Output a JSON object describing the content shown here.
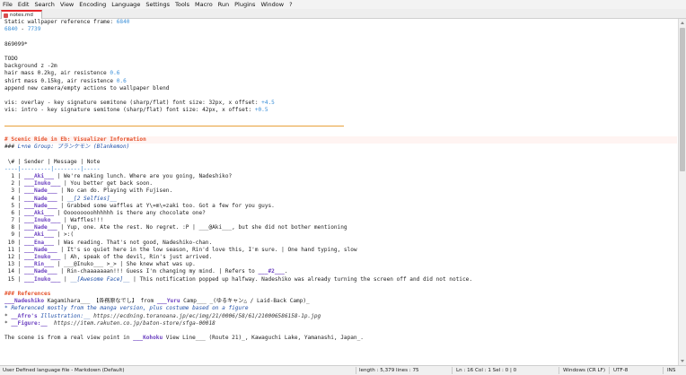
{
  "menu": [
    "File",
    "Edit",
    "Search",
    "View",
    "Encoding",
    "Language",
    "Settings",
    "Tools",
    "Macro",
    "Run",
    "Plugins",
    "Window",
    "?"
  ],
  "tab": {
    "label": "notes.md"
  },
  "lines": [
    [
      {
        "t": "Static wallpaper reference frame: "
      },
      {
        "t": "6840",
        "c": "num"
      }
    ],
    [
      {
        "t": "6840",
        "c": "num"
      },
      {
        "t": " - "
      },
      {
        "t": "7739",
        "c": "num"
      }
    ],
    [
      {
        "t": ""
      }
    ],
    [
      {
        "t": "869099*"
      }
    ],
    [
      {
        "t": ""
      }
    ],
    [
      {
        "t": "TODO"
      }
    ],
    [
      {
        "t": "background z -2m"
      }
    ],
    [
      {
        "t": "hair mass 0.2kg, air resistence "
      },
      {
        "t": "0.6",
        "c": "num"
      }
    ],
    [
      {
        "t": "shirt mass 0.15kg, air resistence "
      },
      {
        "t": "0.6",
        "c": "num"
      }
    ],
    [
      {
        "t": "append new camera/empty actions to wallpaper blend"
      }
    ],
    [
      {
        "t": ""
      }
    ],
    [
      {
        "t": "vis: overlay - key signature semitone (sharp/flat) font size: 32px, x offset: "
      },
      {
        "t": "+4.5",
        "c": "num"
      }
    ],
    [
      {
        "t": "vis: intro - key signature semitone (sharp/flat) font size: 42px, x offset: "
      },
      {
        "t": "+0.5",
        "c": "num"
      }
    ],
    [
      {
        "t": ""
      }
    ],
    [
      {
        "t": "rule",
        "rule": true
      }
    ],
    [
      {
        "t": ""
      }
    ],
    [
      {
        "t": "# Scenic Ride in Eb: Visualizer Information",
        "c": "h1"
      }
    ],
    [
      {
        "t": "### "
      },
      {
        "t": "L+ne Group: ブランケモン (Blankemon)",
        "c": "emph"
      }
    ],
    [
      {
        "t": ""
      }
    ],
    [
      {
        "t": " \\# | Sender | Message | Note"
      }
    ],
    [
      {
        "t": "----|---------|--------|-----",
        "c": "sep"
      }
    ],
    [
      {
        "t": "  1 | "
      },
      {
        "t": "___Aki___",
        "c": "mkd"
      },
      {
        "t": " | We're making lunch. Where are you going, Nadeshiko?"
      }
    ],
    [
      {
        "t": "  2 | "
      },
      {
        "t": "___Inuko___",
        "c": "mkd"
      },
      {
        "t": " | You better get back soon."
      }
    ],
    [
      {
        "t": "  3 | "
      },
      {
        "t": "___Nade___",
        "c": "mkd"
      },
      {
        "t": " | No can do. Playing with Fujisen."
      }
    ],
    [
      {
        "t": "  4 | "
      },
      {
        "t": "___Nade___",
        "c": "mkd"
      },
      {
        "t": " | "
      },
      {
        "t": "__[2 Selfies]__",
        "c": "emph"
      }
    ],
    [
      {
        "t": "  5 | "
      },
      {
        "t": "___Nade___",
        "c": "mkd"
      },
      {
        "t": " | Grabbed some waffles at Y\\=m\\=zaki too. Got a few for you guys."
      }
    ],
    [
      {
        "t": "  6 | "
      },
      {
        "t": "___Aki___",
        "c": "mkd"
      },
      {
        "t": " | Ooooooooohhhhhh is there any chocolate one?"
      }
    ],
    [
      {
        "t": "  7 | "
      },
      {
        "t": "___Inuko___",
        "c": "mkd"
      },
      {
        "t": " | Waffles!!!"
      }
    ],
    [
      {
        "t": "  8 | "
      },
      {
        "t": "___Nade___",
        "c": "mkd"
      },
      {
        "t": " | Yup, one. Ate the rest. No regret. :P | ___@Aki___, but she did not bother mentioning"
      }
    ],
    [
      {
        "t": "  9 | "
      },
      {
        "t": "___Aki___",
        "c": "mkd"
      },
      {
        "t": " | >:("
      }
    ],
    [
      {
        "t": " 10 | "
      },
      {
        "t": "___Ena___",
        "c": "mkd"
      },
      {
        "t": " | Was reading. That's not good, Nadeshiko-chan."
      }
    ],
    [
      {
        "t": " 11 | "
      },
      {
        "t": "___Nade___",
        "c": "mkd"
      },
      {
        "t": " | It's so quiet here in the low season, Rin'd love this, I'm sure. | One hand typing, slow"
      }
    ],
    [
      {
        "t": " 12 | "
      },
      {
        "t": "___Inuko___",
        "c": "mkd"
      },
      {
        "t": " | Ah, speak of the devil, Rin's just arrived."
      }
    ],
    [
      {
        "t": " 13 | "
      },
      {
        "t": "___Rin___",
        "c": "mkd"
      },
      {
        "t": " | ___@Inuko___ >_> | She knew what was up."
      }
    ],
    [
      {
        "t": " 14 | "
      },
      {
        "t": "___Nade___",
        "c": "mkd"
      },
      {
        "t": " | Rin-chaaaaaaan!!! Guess I'm changing my mind. | Refers to "
      },
      {
        "t": "___#2___",
        "c": "mkd"
      },
      {
        "t": "."
      }
    ],
    [
      {
        "t": " 15 | "
      },
      {
        "t": "___Inuko___",
        "c": "mkd"
      },
      {
        "t": " | "
      },
      {
        "t": "__[Awesome Face]__",
        "c": "emph"
      },
      {
        "t": " | This notification popped up halfway. Nadeshiko was already turning the screen off and did not notice."
      }
    ],
    [
      {
        "t": ""
      }
    ],
    [
      {
        "t": "### References",
        "c": "h3"
      }
    ],
    [
      {
        "t": "___Nadeshiko",
        "c": "mkd"
      },
      {
        "t": " Kagamihara___ 【各務原なでし】 from "
      },
      {
        "t": "___Yuru",
        "c": "mkd"
      },
      {
        "t": " Camp___ _(ゆるキャン△ / Laid-Back Camp)_"
      }
    ],
    [
      {
        "t": "* Referenced mostly from the manga version, plus costume based on a figure",
        "c": "emph"
      }
    ],
    [
      {
        "t": "* "
      },
      {
        "t": "__Afro's",
        "c": "mkd"
      },
      {
        "t": " Illustration:__ ",
        "c": "link"
      },
      {
        "t": "https://ecdning.toranoana.jp/ec/img/21/0006/58/61/210006586158-1p.jpg",
        "c": "url"
      }
    ],
    [
      {
        "t": "* "
      },
      {
        "t": "__Figure:__",
        "c": "mkd"
      },
      {
        "t": "  https://item.rakuten.co.jp/baton-store/sfga-00018",
        "c": "url"
      }
    ],
    [
      {
        "t": ""
      }
    ],
    [
      {
        "t": "The scene is from a real view point in "
      },
      {
        "t": "___Kohoku",
        "c": "mkd"
      },
      {
        "t": " View Line___ (Route 21)_, Kawaguchi Lake, Yamanashi, Japan_."
      }
    ]
  ],
  "highlight_line": 16,
  "status": {
    "filetype": "User Defined language file - Markdown (Default)",
    "length": "length : 5,379",
    "lines": "lines : 75",
    "cursor": "Ln : 16   Col : 1   Sel : 0 | 0",
    "eol": "Windows (CR LF)",
    "encoding": "UTF-8",
    "mode": "INS"
  }
}
